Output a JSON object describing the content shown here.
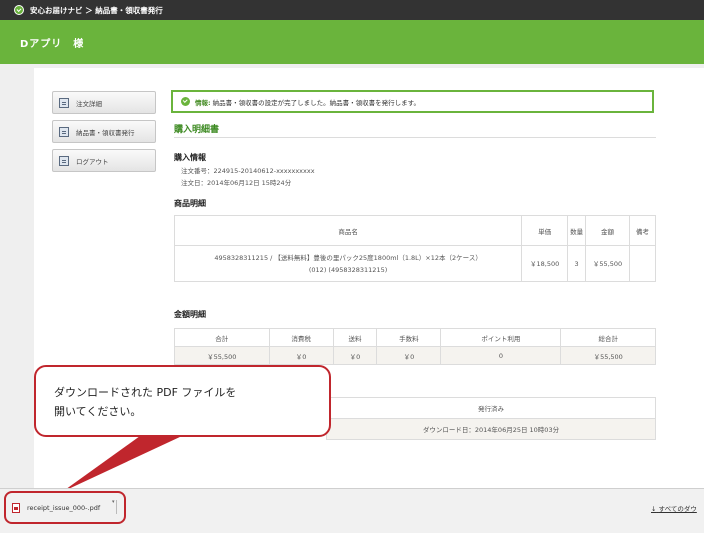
{
  "topbar": {
    "title": "安心お届けナビ ＞ 納品書・領収書発行"
  },
  "header": {
    "user": "Dアプリ　様"
  },
  "sidebar": {
    "items": [
      {
        "label": "注文詳細"
      },
      {
        "label": "納品書・領収書発行"
      },
      {
        "label": "ログアウト"
      }
    ]
  },
  "info": {
    "label": "情報:",
    "message": "納品書・領収書の設定が完了しました。納品書・領収書を発行します。"
  },
  "main": {
    "title": "購入明細書",
    "purchase_info": {
      "heading": "購入情報",
      "order_number": "注文番号：224915-20140612-xxxxxxxxxx",
      "order_date": "注文日：2014年06月12日 15時24分"
    },
    "items": {
      "heading": "商品明細",
      "headers": [
        "商品名",
        "単価",
        "数量",
        "金額",
        "備考"
      ],
      "rows": [
        {
          "name_line1": "4958328311215 / 【送料無料】豊後の里パック25度1800ml（1.8L）×12本（2ケース）",
          "name_line2": "(012) (4958328311215)",
          "price": "￥18,500",
          "qty": "3",
          "amount": "￥55,500",
          "note": ""
        }
      ]
    },
    "amounts": {
      "heading": "金額明細",
      "headers": [
        "合計",
        "消費税",
        "送料",
        "手数料",
        "ポイント利用",
        "総合計"
      ],
      "values": [
        "￥55,500",
        "￥0",
        "￥0",
        "￥0",
        "0",
        "￥55,500"
      ]
    },
    "issue": {
      "status": "発行済み",
      "download_date": "ダウンロード日：2014年06月25日 10時03分"
    }
  },
  "callout": {
    "line1": "ダウンロードされた PDF ファイルを",
    "line2": "開いてください。"
  },
  "download_bar": {
    "file_name": "receipt_issue_000-.pdf",
    "show_all": "すべてのダウ"
  },
  "colors": {
    "brand_green": "#6ab43c",
    "topbar": "#333333",
    "highlight_red": "#c0262d"
  }
}
